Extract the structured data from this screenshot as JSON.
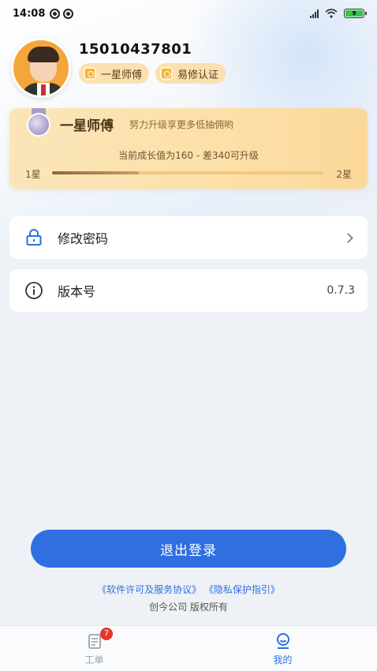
{
  "status_bar": {
    "time": "14:08",
    "battery": "9"
  },
  "profile": {
    "phone": "15010437801",
    "badges": [
      "一星师傅",
      "易修认证"
    ]
  },
  "level": {
    "title": "一星师傅",
    "subtitle": "努力升级享更多低抽佣哟",
    "progress_text": "当前成长值为160 - 差340可升级",
    "from_label": "1星",
    "to_label": "2星",
    "progress_fraction": 0.32
  },
  "menu": {
    "change_password": {
      "label": "修改密码",
      "icon": "lock-icon"
    },
    "version": {
      "label": "版本号",
      "value": "0.7.3",
      "icon": "info-icon"
    }
  },
  "logout_label": "退出登录",
  "footer": {
    "license_link": "《软件许可及服务协议》",
    "privacy_link": "《隐私保护指引》",
    "copyright": "创今公司 版权所有"
  },
  "nav": {
    "work_orders": {
      "label": "工单",
      "badge": "7"
    },
    "mine": {
      "label": "我的"
    }
  },
  "colors": {
    "accent": "#2f6fe0",
    "badge_red": "#e8352b",
    "gold_card": "#fce0a8"
  }
}
